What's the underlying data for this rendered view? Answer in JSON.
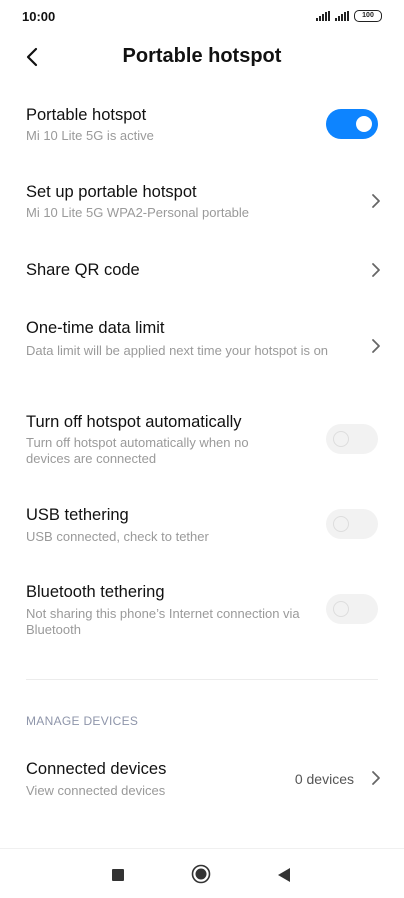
{
  "status_bar": {
    "time": "10:00",
    "battery": "100"
  },
  "header": {
    "title": "Portable hotspot"
  },
  "rows": [
    {
      "title": "Portable hotspot",
      "subtitle": "Mi 10 Lite 5G is active",
      "toggle": true
    },
    {
      "title": "Set up portable hotspot",
      "subtitle": "Mi 10 Lite 5G WPA2-Personal portable"
    },
    {
      "title": "Share QR code"
    },
    {
      "title": "One-time data limit",
      "subtitle": "Data limit will be applied next time your hotspot is on"
    },
    {
      "title": "Turn off hotspot automatically",
      "subtitle": "Turn off hotspot automatically when no devices are connected",
      "toggle": false
    },
    {
      "title": "USB tethering",
      "subtitle": "USB connected, check to tether",
      "toggle": false
    },
    {
      "title": "Bluetooth tethering",
      "subtitle": "Not sharing this phone’s Internet connection via Bluetooth",
      "toggle": false
    }
  ],
  "manage_devices": {
    "header": "MANAGE DEVICES",
    "connected": {
      "title": "Connected devices",
      "subtitle": "View connected devices",
      "value": "0 devices"
    }
  },
  "colors": {
    "accent": "#0d84ff",
    "toggle_off": "#f2f2f2",
    "subtitle": "#9a9a9a",
    "section_header": "#8e95aa"
  },
  "icons": [
    "back-arrow-icon",
    "chevron-right-icon",
    "signal-icon",
    "battery-icon",
    "recent-apps-icon",
    "home-icon",
    "nav-back-icon"
  ]
}
